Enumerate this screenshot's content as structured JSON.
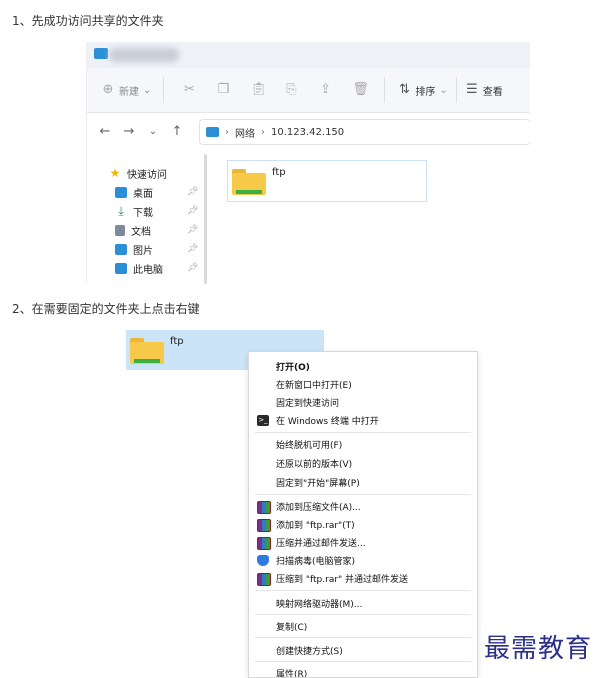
{
  "step1": "1、先成功访问共享的文件夹",
  "step2": "2、在需要固定的文件夹上点击右键",
  "explorer": {
    "toolbar": {
      "new_label": "新建",
      "sort_label": "排序",
      "view_label": "查看"
    },
    "address": {
      "root": "网络",
      "host": "10.123.42.150"
    },
    "nav_items": [
      {
        "label": "快速访问",
        "icon": "star-icon",
        "color": "#f2b600"
      },
      {
        "label": "桌面",
        "icon": "desktop-icon",
        "color": "#2b8fd8"
      },
      {
        "label": "下载",
        "icon": "download-icon",
        "color": "#1f8f4e"
      },
      {
        "label": "文档",
        "icon": "document-icon",
        "color": "#7d8a99"
      },
      {
        "label": "图片",
        "icon": "picture-icon",
        "color": "#2b8fd8"
      },
      {
        "label": "此电脑",
        "icon": "computer-icon",
        "color": "#2b8fd8"
      }
    ],
    "folder_name": "ftp"
  },
  "selected_folder_name": "ftp",
  "context_menu": {
    "groups": [
      [
        "打开(O)",
        "在新窗口中打开(E)",
        "固定到快速访问",
        "在 Windows 终端 中打开"
      ],
      [
        "始终脱机可用(F)",
        "还原以前的版本(V)",
        "固定到\"开始\"屏幕(P)"
      ],
      [
        "添加到压缩文件(A)...",
        "添加到 \"ftp.rar\"(T)",
        "压缩并通过邮件发送...",
        "扫描病毒(电脑管家)",
        "压缩到 \"ftp.rar\" 并通过邮件发送"
      ],
      [
        "映射网络驱动器(M)..."
      ],
      [
        "复制(C)"
      ],
      [
        "创建快捷方式(S)"
      ],
      [
        "属性(R)"
      ]
    ]
  },
  "watermark": "最需教育"
}
